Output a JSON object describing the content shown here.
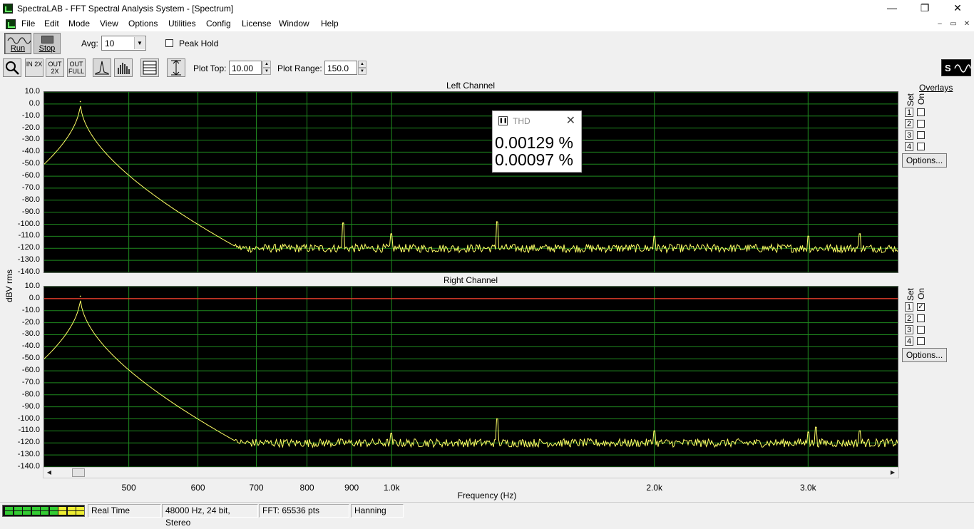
{
  "window": {
    "title": "SpectraLAB - FFT Spectral Analysis System - [Spectrum]",
    "minimize": "—",
    "restore": "❐",
    "close": "✕"
  },
  "menu": {
    "items": [
      "File",
      "Edit",
      "Mode",
      "View",
      "Options",
      "Utilities",
      "Config",
      "License",
      "Window",
      "Help"
    ],
    "mdi_min": "–",
    "mdi_restore": "▭",
    "mdi_close": "✕"
  },
  "toolbar": {
    "run_label": "Run",
    "stop_label": "Stop",
    "avg_label": "Avg:",
    "avg_value": "10",
    "peak_hold_label": "Peak Hold",
    "peak_hold_checked": false,
    "plot_top_label": "Plot Top:",
    "plot_top_value": "10.00",
    "plot_range_label": "Plot Range:",
    "plot_range_value": "150.0",
    "zoom_in_2x": "IN 2X",
    "zoom_out_2x": "OUT 2X",
    "zoom_out_full": "OUT FULL"
  },
  "plots": {
    "left_title": "Left Channel",
    "right_title": "Right Channel",
    "y_axis_label": "dBV rms",
    "x_axis_label": "Frequency (Hz)",
    "y_ticks": [
      "10.0",
      "0.0",
      "-10.0",
      "-20.0",
      "-30.0",
      "-40.0",
      "-50.0",
      "-60.0",
      "-70.0",
      "-80.0",
      "-90.0",
      "-100.0",
      "-110.0",
      "-120.0",
      "-130.0",
      "-140.0"
    ],
    "x_ticks": [
      "500",
      "600",
      "700",
      "800",
      "900",
      "1.0k",
      "2.0k",
      "3.0k"
    ],
    "overlays_label": "Overlays",
    "set_label": "Set",
    "on_label": "On",
    "overlay_numbers": [
      "1",
      "2",
      "3",
      "4"
    ],
    "left_overlays_on": [
      false,
      false,
      false,
      false
    ],
    "right_overlays_on": [
      true,
      false,
      false,
      false
    ],
    "options_label": "Options...",
    "right_overlay_1_level_db": 0.0
  },
  "thd": {
    "title": "THD",
    "left_value": "0.00129 %",
    "right_value": "0.00097 %"
  },
  "chart_data": [
    {
      "type": "line",
      "title": "Left Channel",
      "xlabel": "Frequency (Hz)",
      "ylabel": "dBV rms",
      "x_scale": "log",
      "xlim": [
        400,
        3800
      ],
      "ylim": [
        -140,
        10
      ],
      "grid": true,
      "noise_floor_db": -120,
      "peaks": [
        {
          "x": 440,
          "y": 2
        },
        {
          "x": 880,
          "y": -99
        },
        {
          "x": 1000,
          "y": -108
        },
        {
          "x": 1320,
          "y": -98
        },
        {
          "x": 2000,
          "y": -110
        },
        {
          "x": 3000,
          "y": -110
        },
        {
          "x": 3440,
          "y": -108
        }
      ]
    },
    {
      "type": "line",
      "title": "Right Channel",
      "xlabel": "Frequency (Hz)",
      "ylabel": "dBV rms",
      "x_scale": "log",
      "xlim": [
        400,
        3800
      ],
      "ylim": [
        -140,
        10
      ],
      "grid": true,
      "noise_floor_db": -120,
      "peaks": [
        {
          "x": 440,
          "y": 2
        },
        {
          "x": 1000,
          "y": -112
        },
        {
          "x": 1320,
          "y": -100
        },
        {
          "x": 2000,
          "y": -110
        },
        {
          "x": 3000,
          "y": -111
        },
        {
          "x": 3060,
          "y": -107
        },
        {
          "x": 3440,
          "y": -110
        }
      ]
    }
  ],
  "status": {
    "mode": "Real Time",
    "format": "48000 Hz, 24 bit, Stereo",
    "fft": "FFT: 65536 pts",
    "window": "Hanning"
  },
  "colors": {
    "trace": "#ffff66",
    "grid": "#1f8a1f",
    "overlay": "#ff3b2f",
    "plot_bg": "#000000"
  }
}
